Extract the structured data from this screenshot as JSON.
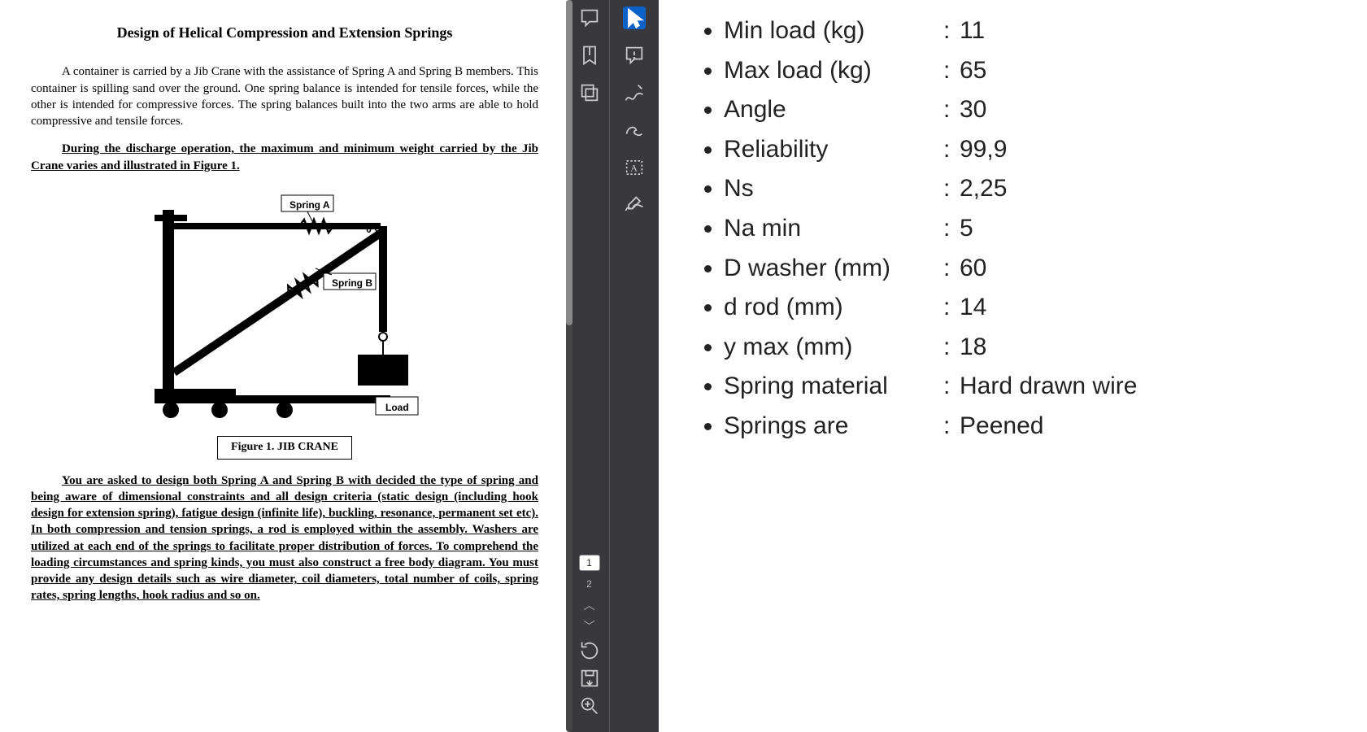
{
  "pdf": {
    "title": "Design of Helical Compression and Extension Springs",
    "para1": "A container is carried by a Jib Crane with the assistance of Spring A and Spring B members. This container is spilling sand over the ground. One spring balance is intended for tensile forces, while the other is intended for compressive forces. The spring balances built into the two arms are able to hold compressive and tensile forces.",
    "para2": "During the discharge operation, the maximum and minimum weight carried by the Jib Crane varies and illustrated in Figure 1.",
    "figure": {
      "spring_a_label": "Spring A",
      "spring_b_label": "Spring B",
      "theta_label": "θ",
      "load_label": "Load",
      "caption": "Figure 1. JIB CRANE"
    },
    "para3": "You are asked to design both Spring A and Spring B with decided the type of spring and being aware of dimensional constraints and all design criteria (static design (including hook design for extension spring), fatigue design (infinite life), buckling, resonance, permanent set etc). In both compression and tension springs, a rod is employed within the assembly. Washers are utilized at each end of the springs to facilitate proper distribution of forces. To comprehend the loading circumstances and spring kinds, you must also construct a free body diagram. You must provide any design details such as wire diameter, coil diameters, total number of coils, spring rates, spring lengths, hook radius and so on."
  },
  "toolbar": {
    "page1": "1",
    "page2": "2"
  },
  "specs": {
    "items": [
      {
        "label": "Min load  (kg)",
        "value": "11"
      },
      {
        "label": "Max load  (kg)",
        "value": "65"
      },
      {
        "label": "Angle",
        "value": "30"
      },
      {
        "label": "Reliability",
        "value": "99,9"
      },
      {
        "label": "Ns",
        "value": "2,25"
      },
      {
        "label": "Na min",
        "value": "5"
      },
      {
        "label": "D washer (mm)",
        "value": "60"
      },
      {
        "label": "d rod (mm)",
        "value": "14"
      },
      {
        "label": "y max (mm)",
        "value": "18"
      },
      {
        "label": "Spring material",
        "value": "Hard drawn wire"
      },
      {
        "label": "Springs are",
        "value": "Peened"
      }
    ]
  }
}
